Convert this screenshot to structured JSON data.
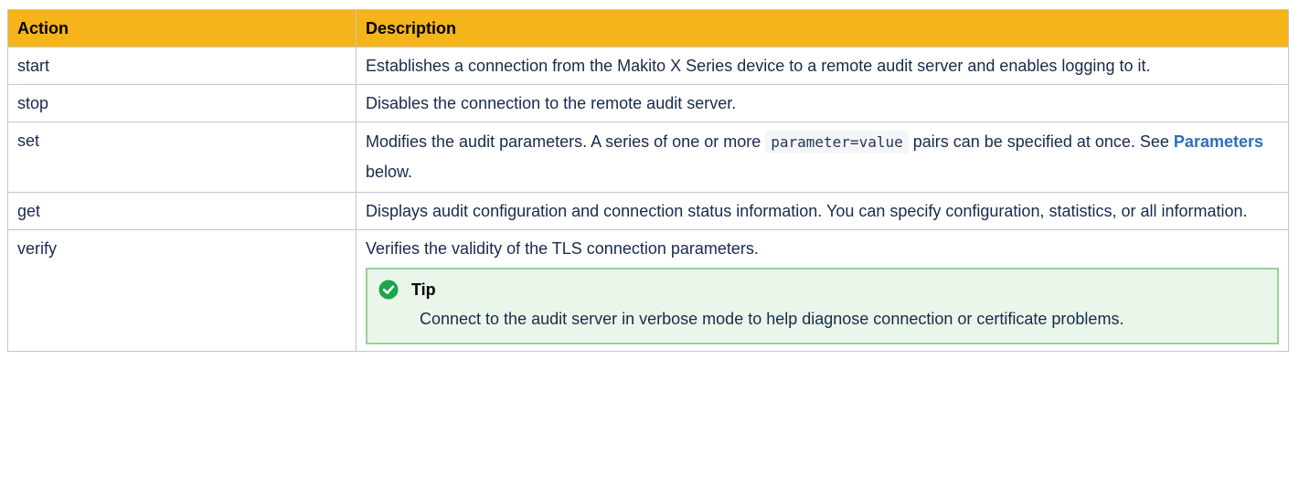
{
  "table": {
    "headers": {
      "action": "Action",
      "description": "Description"
    },
    "rows": [
      {
        "action": "start",
        "description": "Establishes a connection from the Makito X Series device to a remote audit server and enables logging to it."
      },
      {
        "action": "stop",
        "description": "Disables the connection to the remote audit server."
      },
      {
        "action": "set",
        "description_before": "Modifies the audit parameters. A series of one or more ",
        "code": "parameter=value",
        "description_middle": " pairs can be specified at once. See ",
        "link": "Parameters",
        "description_after": " below."
      },
      {
        "action": "get",
        "description": "Displays audit configuration and connection status information. You can specify configuration, statistics, or all information."
      },
      {
        "action": "verify",
        "description": "Verifies the validity of the TLS connection parameters.",
        "tip": {
          "title": "Tip",
          "icon": "check-circle-icon",
          "body": "Connect to the audit server in verbose mode to help diagnose connection or certificate problems."
        }
      }
    ]
  },
  "colors": {
    "header_bg": "#f4b41a",
    "tip_border": "#97d19a",
    "tip_bg": "#eaf6ea",
    "tip_icon": "#1ea54a",
    "link": "#2c6ebd"
  }
}
